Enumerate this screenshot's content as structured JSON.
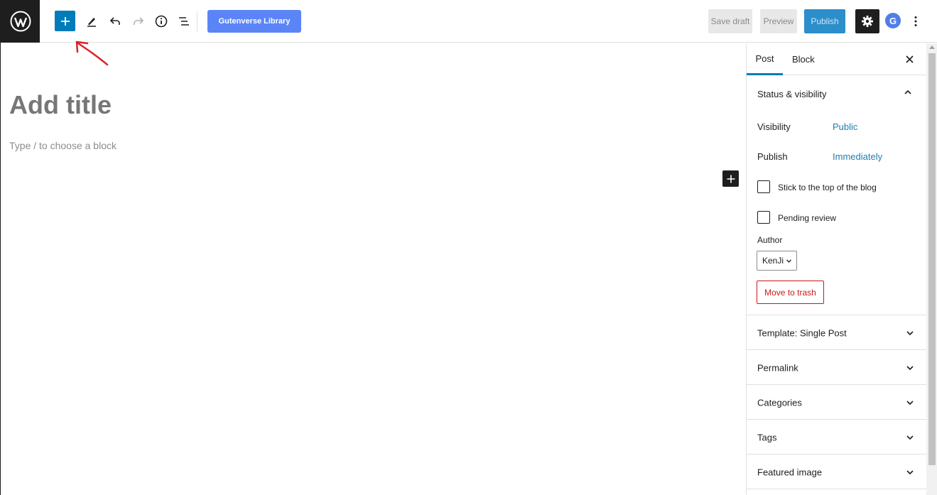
{
  "toolbar": {
    "wp_logo_icon": "wordpress-icon",
    "inserter_icon": "plus-icon",
    "tools_icon": "pencil-icon",
    "undo_icon": "undo-icon",
    "redo_icon": "redo-icon",
    "details_icon": "info-icon",
    "list_view_icon": "list-view-icon",
    "gutenverse_label": "Gutenverse Library",
    "save_draft_label": "Save draft",
    "preview_label": "Preview",
    "publish_label": "Publish",
    "settings_icon": "gear-icon",
    "avatar_letter": "G",
    "more_icon": "vertical-ellipsis-icon",
    "accent_color": "#007cba"
  },
  "editor": {
    "title_placeholder": "Add title",
    "block_placeholder": "Type / to choose a block"
  },
  "sidebar": {
    "tabs": [
      {
        "label": "Post",
        "active": true
      },
      {
        "label": "Block",
        "active": false
      }
    ],
    "status_panel": {
      "title": "Status & visibility",
      "expanded": true,
      "visibility_label": "Visibility",
      "visibility_value": "Public",
      "publish_label": "Publish",
      "publish_value": "Immediately",
      "sticky_label": "Stick to the top of the blog",
      "sticky_checked": false,
      "pending_label": "Pending review",
      "pending_checked": false,
      "author_label": "Author",
      "author_value": "KenJi",
      "trash_label": "Move to trash"
    },
    "panels": [
      {
        "label": "Template: Single Post"
      },
      {
        "label": "Permalink"
      },
      {
        "label": "Categories"
      },
      {
        "label": "Tags"
      },
      {
        "label": "Featured image"
      }
    ]
  }
}
